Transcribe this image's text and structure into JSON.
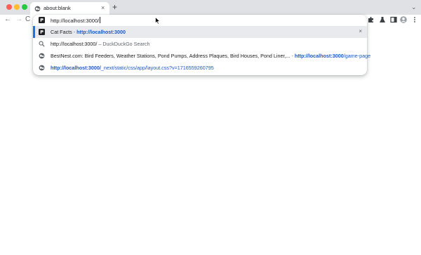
{
  "tab": {
    "title": "about:blank",
    "close": "×"
  },
  "new_tab": "+",
  "tab_menu": "⌄",
  "nav": {
    "back": "←",
    "forward": "→",
    "reload": "C"
  },
  "omnibox": {
    "value": "http://localhost:3000/",
    "suggestions": [
      {
        "title": "Cat Facts",
        "sep": " - ",
        "url_bold": "http://localhost:3000",
        "url_rest": "",
        "remove": "×",
        "icon": "site-favicon"
      },
      {
        "title": "http://localhost:3000/",
        "sep": " – ",
        "source": "DuckDuckGo Search",
        "icon": "search-icon"
      },
      {
        "title": "BestNest.com: Bird Feeders, Weather Stations, Pond Pumps, Address Plaques, Bird Houses, Pond Liner,...",
        "sep": " - ",
        "url_bold": "http://localhost:3000",
        "url_rest": "/game-page",
        "icon": "globe-icon"
      },
      {
        "url_bold": "http://localhost:3000/",
        "url_rest": "_next/static/css/app/layout.css?v=1716559260795",
        "icon": "globe-icon"
      }
    ]
  },
  "colors": {
    "tabstrip": "#dfe1e5",
    "selected_row": "#e8eaed",
    "accent": "#1a73e8",
    "url": "#1a56c4"
  }
}
